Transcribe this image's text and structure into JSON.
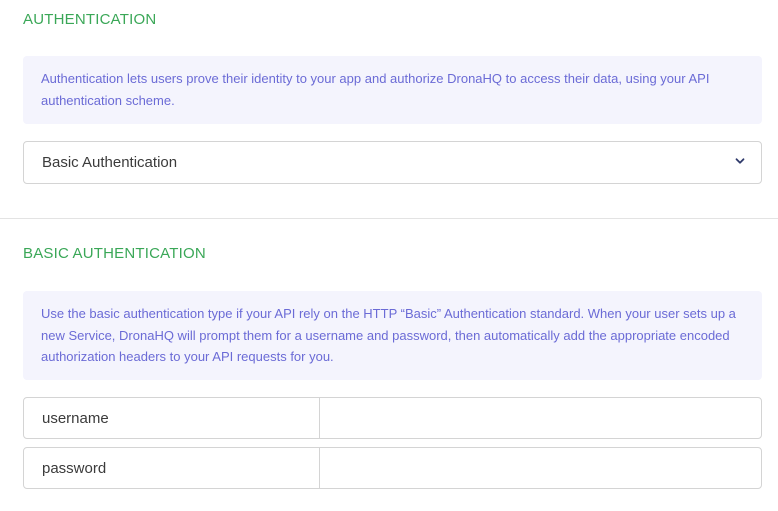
{
  "authentication": {
    "heading": "AUTHENTICATION",
    "info": "Authentication lets users prove their identity to your app and authorize DronaHQ to access their data, using your API authentication scheme.",
    "select": {
      "value": "Basic Authentication",
      "icon": "chevron-down-icon"
    }
  },
  "basic_auth": {
    "heading": "BASIC AUTHENTICATION",
    "info": "Use the basic authentication type if your API rely on the HTTP “Basic” Authentication standard. When your user sets up a new Service, DronaHQ will prompt them for a username and password, then automatically add the appropriate encoded authorization headers to your API requests for you.",
    "fields": [
      {
        "key": "username",
        "value": ""
      },
      {
        "key": "password",
        "value": ""
      }
    ]
  },
  "colors": {
    "heading": "#3aa757",
    "info_text": "#6b6bd6",
    "info_bg": "#f4f4fd",
    "border": "#d4d4d4"
  }
}
